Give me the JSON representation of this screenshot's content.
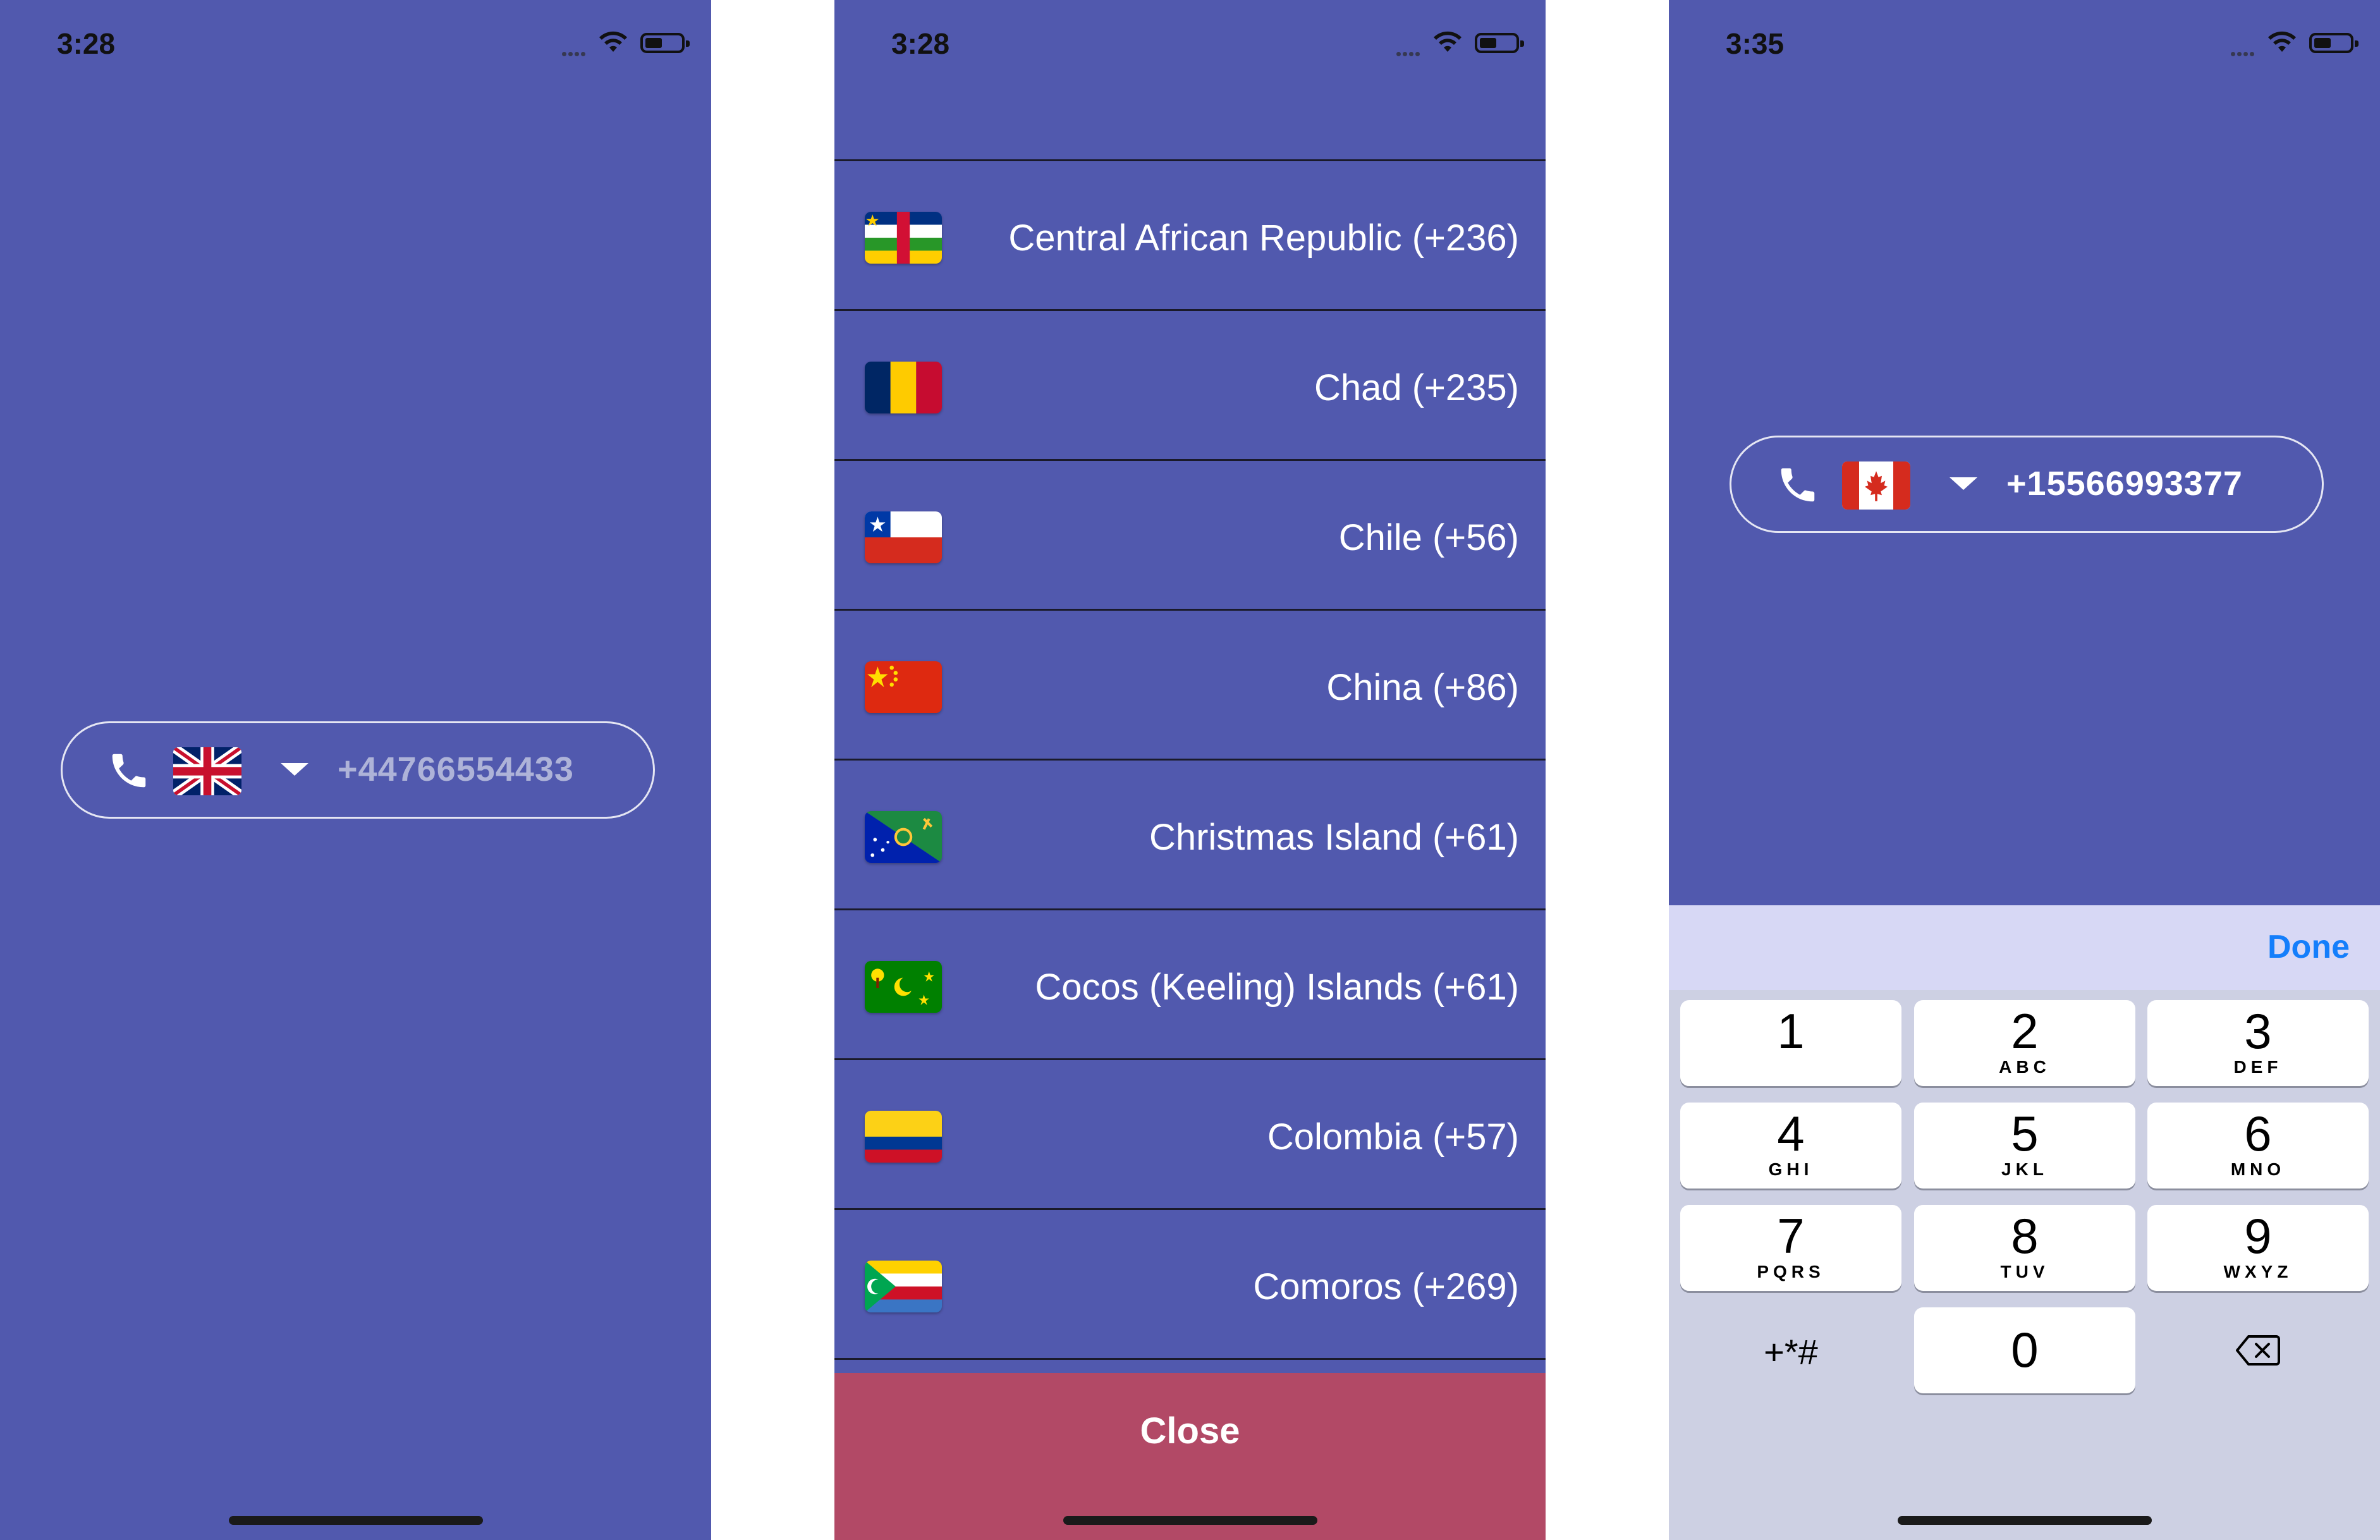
{
  "screens": [
    {
      "status": {
        "time": "3:28"
      },
      "phone_input": {
        "country": "United Kingdom",
        "placeholder": "+44766554433"
      }
    },
    {
      "status": {
        "time": "3:28"
      },
      "country_list": [
        {
          "label": "Central African Republic (+236)",
          "flag": "central-african-republic-flag"
        },
        {
          "label": "Chad (+235)",
          "flag": "chad-flag"
        },
        {
          "label": "Chile (+56)",
          "flag": "chile-flag"
        },
        {
          "label": "China (+86)",
          "flag": "china-flag"
        },
        {
          "label": "Christmas Island (+61)",
          "flag": "christmas-island-flag"
        },
        {
          "label": "Cocos (Keeling) Islands (+61)",
          "flag": "cocos-islands-flag"
        },
        {
          "label": "Colombia (+57)",
          "flag": "colombia-flag"
        },
        {
          "label": "Comoros (+269)",
          "flag": "comoros-flag"
        }
      ],
      "close_label": "Close"
    },
    {
      "status": {
        "time": "3:35"
      },
      "phone_input": {
        "country": "Canada",
        "value": "+15566993377"
      },
      "keyboard": {
        "done_label": "Done",
        "keys": [
          {
            "digit": "1",
            "letters": ""
          },
          {
            "digit": "2",
            "letters": "ABC"
          },
          {
            "digit": "3",
            "letters": "DEF"
          },
          {
            "digit": "4",
            "letters": "GHI"
          },
          {
            "digit": "5",
            "letters": "JKL"
          },
          {
            "digit": "6",
            "letters": "MNO"
          },
          {
            "digit": "7",
            "letters": "PQRS"
          },
          {
            "digit": "8",
            "letters": "TUV"
          },
          {
            "digit": "9",
            "letters": "WXYZ"
          },
          {
            "digit": "+*#",
            "letters": ""
          },
          {
            "digit": "0",
            "letters": ""
          }
        ]
      }
    }
  ],
  "colors": {
    "app_background": "#5159AE",
    "close_bar": "#B24966",
    "keyboard_toolbar": "#D7D8F5",
    "keypad": "#CDD0E3",
    "done": "#147EFB"
  }
}
